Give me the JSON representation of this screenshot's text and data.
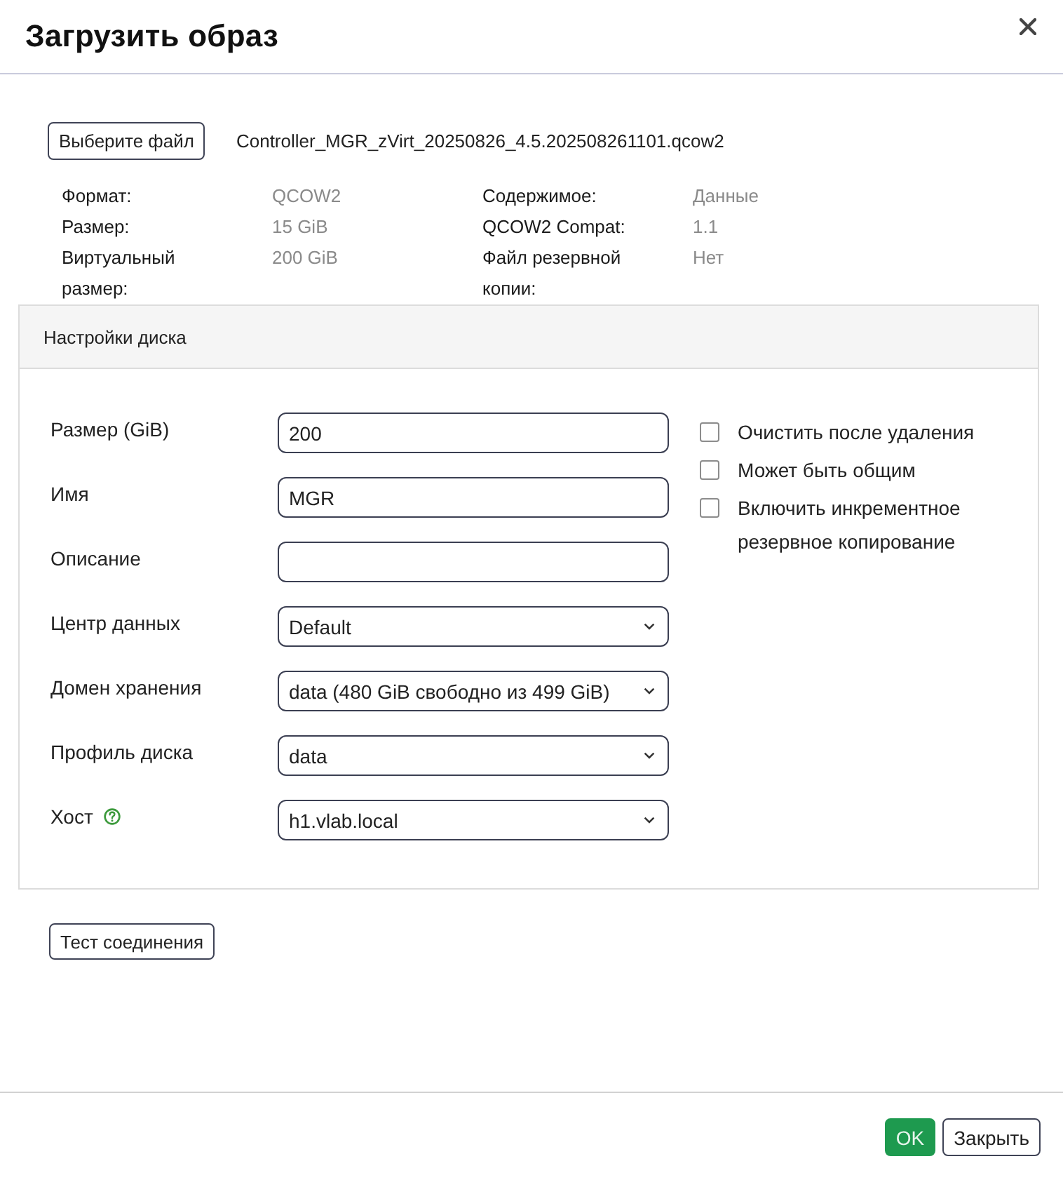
{
  "dialog": {
    "title": "Загрузить образ"
  },
  "file": {
    "button": "Выберите файл",
    "name": "Controller_MGR_zVirt_20250826_4.5.202508261101.qcow2"
  },
  "image_info": [
    [
      {
        "label": "Формат:",
        "value": "QCOW2"
      },
      {
        "label": "Размер:",
        "value": "15 GiB"
      },
      {
        "label": "Виртуальный размер:",
        "value": "200 GiB"
      }
    ],
    [
      {
        "label": "Содержимое:",
        "value": "Данные"
      },
      {
        "label": "QCOW2 Compat:",
        "value": "1.1"
      },
      {
        "label": "Файл резервной копии:",
        "value": "Нет"
      }
    ]
  ],
  "disk_settings": {
    "title": "Настройки диска",
    "fields": [
      {
        "kind": "input",
        "label": "Размер (GiB)",
        "value": "200"
      },
      {
        "kind": "input",
        "label": "Имя",
        "value": "MGR"
      },
      {
        "kind": "input",
        "label": "Описание"
      },
      {
        "kind": "select",
        "label": "Центр данных",
        "value": "Default"
      },
      {
        "kind": "select",
        "label": "Домен хранения",
        "value": "data (480 GiB свободно из 499 GiB)"
      },
      {
        "kind": "select",
        "label": "Профиль диска",
        "value": "data"
      },
      {
        "kind": "select",
        "label": "Хост",
        "value": "h1.vlab.local",
        "help": true
      }
    ],
    "options": [
      {
        "label": "Очистить после удаления",
        "checked": false
      },
      {
        "label": "Может быть общим",
        "checked": false
      },
      {
        "label": "Включить инкрементное резервное копирование",
        "checked": false
      }
    ]
  },
  "test_button": "Тест соединения",
  "footer": {
    "buttons": [
      {
        "label": "OK",
        "kind": "primary"
      },
      {
        "label": "Закрыть",
        "kind": "secondary"
      }
    ]
  }
}
